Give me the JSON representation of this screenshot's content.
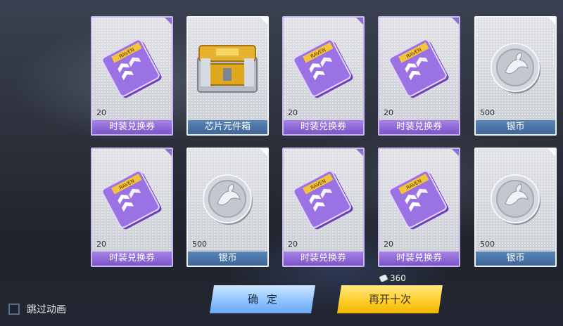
{
  "cards": [
    {
      "type": "voucher",
      "quantity": "20",
      "label": "时装兑换券"
    },
    {
      "type": "chest",
      "quantity": "",
      "label": "芯片元件箱"
    },
    {
      "type": "voucher",
      "quantity": "20",
      "label": "时装兑换券"
    },
    {
      "type": "voucher",
      "quantity": "20",
      "label": "时装兑换券"
    },
    {
      "type": "coin",
      "quantity": "500",
      "label": "银币"
    },
    {
      "type": "voucher",
      "quantity": "20",
      "label": "时装兑换券"
    },
    {
      "type": "coin",
      "quantity": "500",
      "label": "银币"
    },
    {
      "type": "voucher",
      "quantity": "20",
      "label": "时装兑换券"
    },
    {
      "type": "voucher",
      "quantity": "20",
      "label": "时装兑换券"
    },
    {
      "type": "coin",
      "quantity": "500",
      "label": "银币"
    }
  ],
  "voucher_brand": "RAVEN",
  "skip_animation": {
    "label": "跳过动画",
    "checked": false
  },
  "buttons": {
    "confirm": "确定",
    "draw_again": "再开十次"
  },
  "cost": {
    "icon": "ticket-icon",
    "value": "360"
  },
  "colors": {
    "purple_label": "#8c67d6",
    "blue_label": "#4a72a6",
    "confirm": "#8fc4ff",
    "draw_again": "#ffcf2e"
  }
}
